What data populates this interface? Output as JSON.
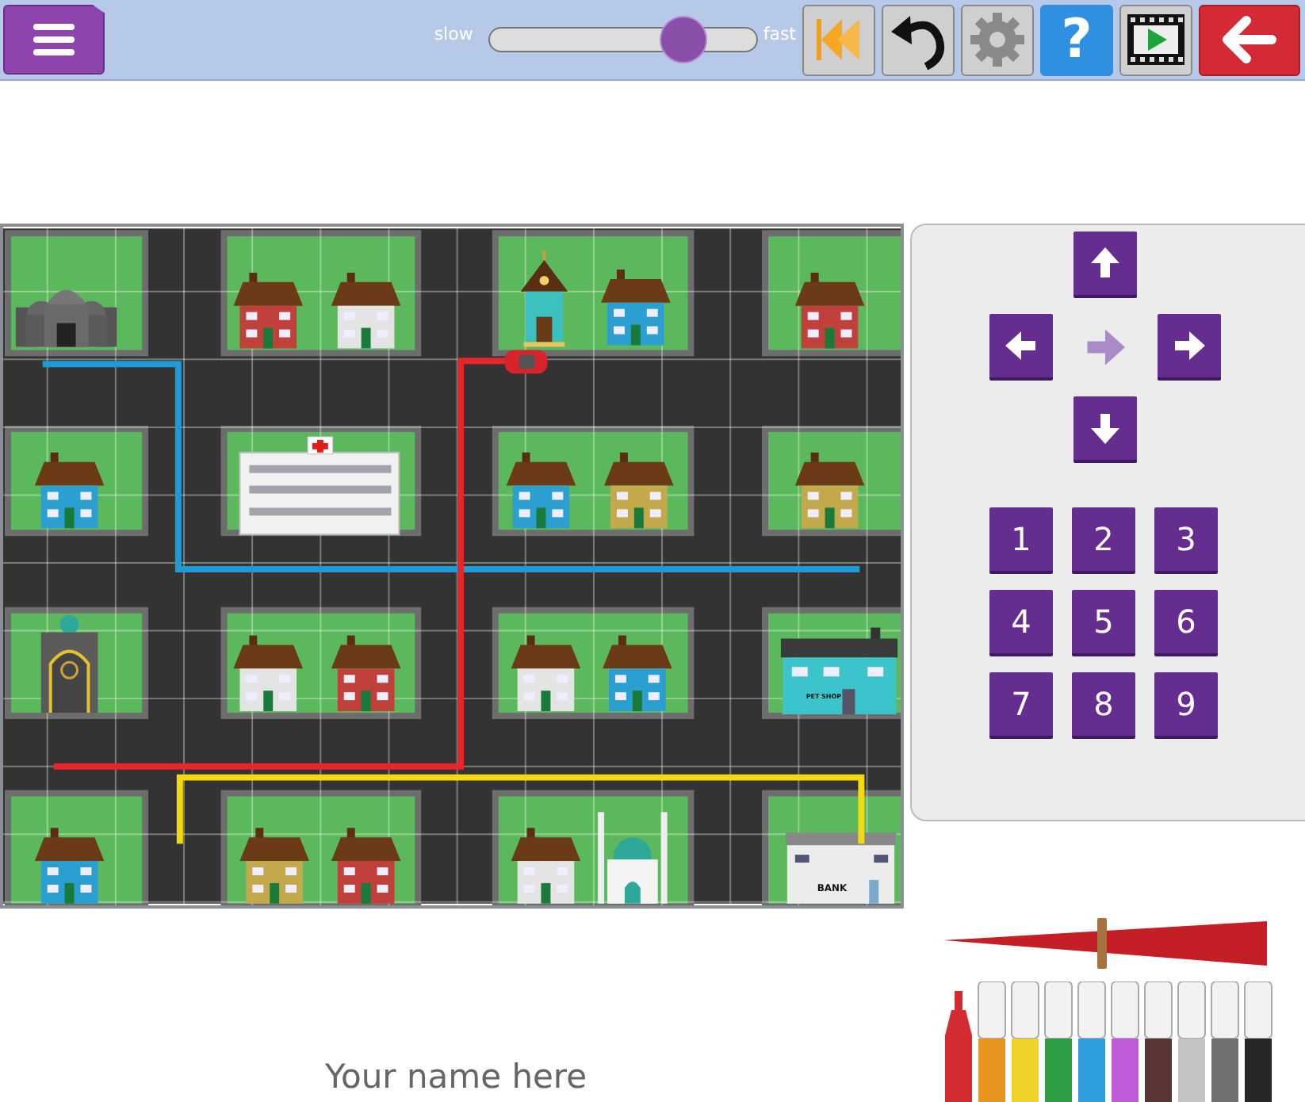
{
  "toolbar": {
    "help_label": "?",
    "speed": {
      "slow_label": "slow",
      "fast_label": "fast",
      "level": 0.72
    }
  },
  "map": {
    "routes": [
      {
        "color": "#1e9ad6"
      },
      {
        "color": "#e8262a"
      },
      {
        "color": "#f5d90f"
      }
    ],
    "pet_shop_sign": "PET SHOP",
    "bank_sign": "BANK"
  },
  "controls": {
    "heading_arrow": {
      "kind": "right"
    },
    "number_keys": [
      "1",
      "2",
      "3",
      "4",
      "5",
      "6",
      "7",
      "8",
      "9"
    ]
  },
  "name_field": {
    "placeholder": "Your name here"
  },
  "pen": {
    "size": {
      "level": 0.49
    },
    "markers": [
      {
        "color": "#d22b30",
        "selected": true
      },
      {
        "color": "#e8951f",
        "selected": false
      },
      {
        "color": "#efd22a",
        "selected": false
      },
      {
        "color": "#2e9e45",
        "selected": false
      },
      {
        "color": "#2f9ede",
        "selected": false
      },
      {
        "color": "#c05bd8",
        "selected": false
      },
      {
        "color": "#5a3535",
        "selected": false
      },
      {
        "color": "#c3c3c3",
        "selected": false
      },
      {
        "color": "#707070",
        "selected": false
      },
      {
        "color": "#262626",
        "selected": false
      }
    ]
  }
}
